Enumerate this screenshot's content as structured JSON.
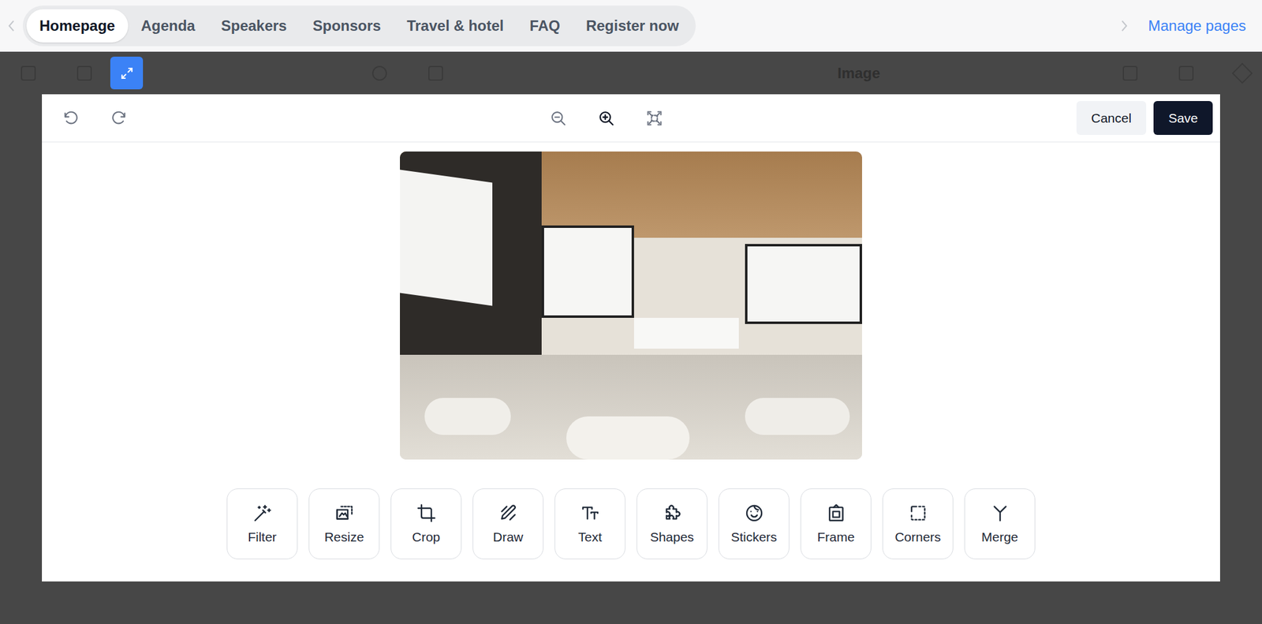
{
  "top_bar": {
    "tabs": [
      {
        "label": "Homepage",
        "selected": true
      },
      {
        "label": "Agenda",
        "selected": false
      },
      {
        "label": "Speakers",
        "selected": false
      },
      {
        "label": "Sponsors",
        "selected": false
      },
      {
        "label": "Travel & hotel",
        "selected": false
      },
      {
        "label": "FAQ",
        "selected": false
      },
      {
        "label": "Register now",
        "selected": false
      }
    ],
    "manage_pages": "Manage pages"
  },
  "background": {
    "panel_title": "Image"
  },
  "editor": {
    "toolbar": {
      "undo": {
        "disabled": true
      },
      "redo": {
        "disabled": true
      },
      "zoom_out": {
        "disabled": true
      },
      "zoom_in": {
        "disabled": false
      },
      "fit": {
        "disabled": true
      }
    },
    "cancel": "Cancel",
    "save": "Save",
    "tools": [
      {
        "label": "Filter"
      },
      {
        "label": "Resize"
      },
      {
        "label": "Crop"
      },
      {
        "label": "Draw"
      },
      {
        "label": "Text"
      },
      {
        "label": "Shapes"
      },
      {
        "label": "Stickers"
      },
      {
        "label": "Frame"
      },
      {
        "label": "Corners"
      },
      {
        "label": "Merge"
      }
    ]
  }
}
